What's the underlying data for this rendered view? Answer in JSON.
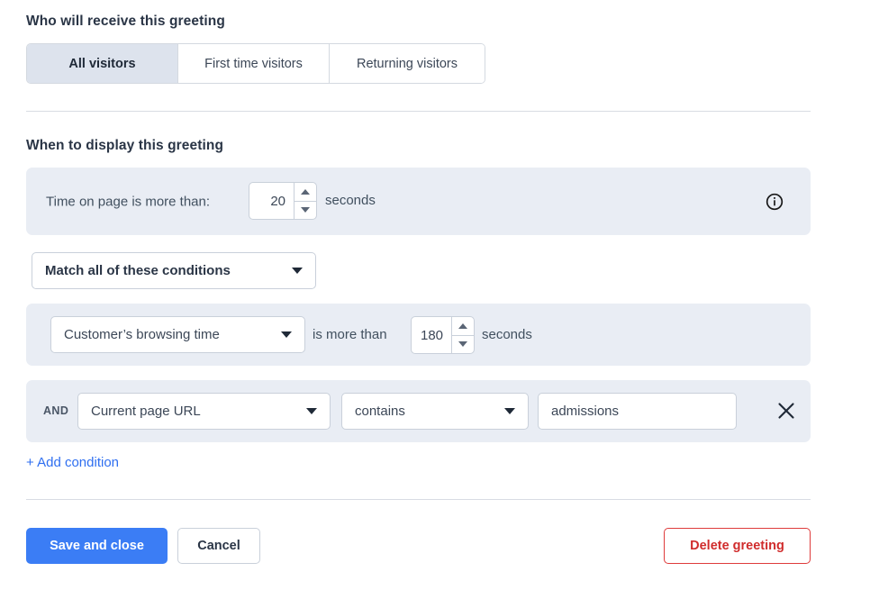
{
  "audience": {
    "title": "Who will receive this greeting",
    "options": [
      {
        "label": "All visitors",
        "selected": true
      },
      {
        "label": "First time visitors",
        "selected": false
      },
      {
        "label": "Returning visitors",
        "selected": false
      }
    ]
  },
  "timing": {
    "title": "When to display this greeting",
    "time_on_page": {
      "label": "Time on page is more than:",
      "value": "20",
      "unit": "seconds",
      "info_icon": "info-circle-icon"
    },
    "match_mode": {
      "value": "Match all of these conditions",
      "caret_icon": "chevron-down-icon"
    },
    "conditions": [
      {
        "joiner": "",
        "subject": "Customer’s browsing time",
        "operator_text": "is more than",
        "value": "180",
        "unit": "seconds"
      },
      {
        "joiner": "AND",
        "subject": "Current page URL",
        "operator": "contains",
        "value": "admissions",
        "value_placeholder": "",
        "remove_icon": "close-icon"
      }
    ],
    "add_condition_label": "+ Add condition"
  },
  "footer": {
    "save_label": "Save and close",
    "cancel_label": "Cancel",
    "delete_label": "Delete greeting"
  },
  "colors": {
    "primary": "#3b7df5",
    "danger": "#d02c2c",
    "link": "#2f6ff0",
    "panel_bg": "#e9edf4",
    "selected_tab_bg": "#dde3ed"
  }
}
